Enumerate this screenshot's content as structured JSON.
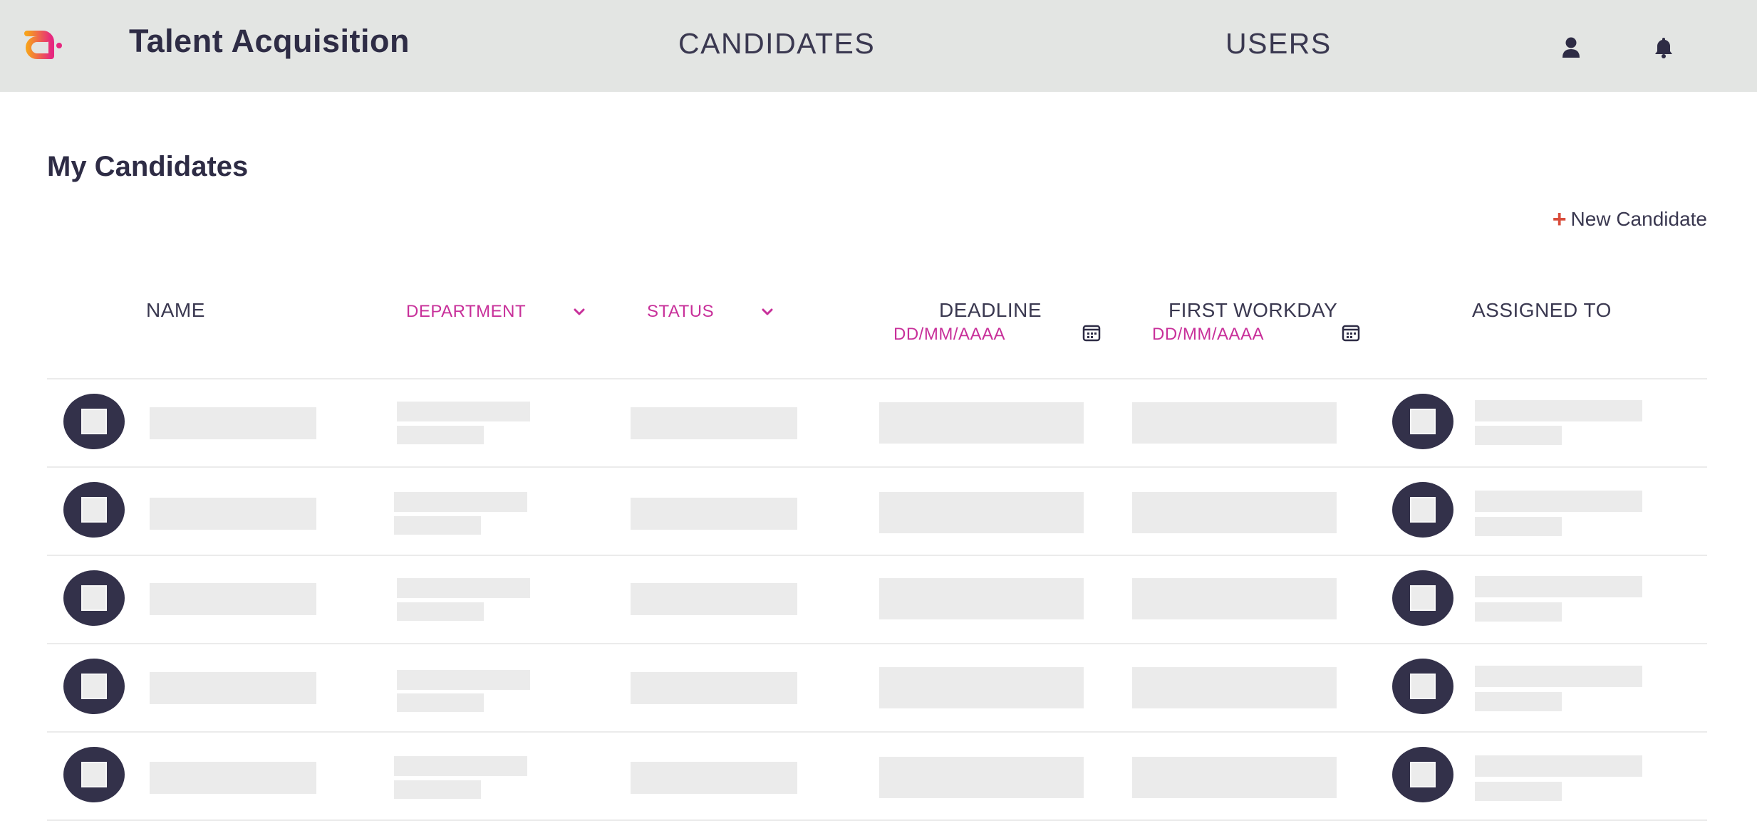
{
  "app": {
    "title": "Talent Acquisition",
    "brand_colors": {
      "logo_orange": "#f7a21b",
      "logo_magenta": "#e6287f"
    }
  },
  "nav": {
    "candidates_label": "CANDIDATES",
    "users_label": "USERS",
    "icons": [
      "user-icon",
      "bell-icon"
    ]
  },
  "page": {
    "title": "My Candidates",
    "new_candidate_label": "New Candidate"
  },
  "table": {
    "columns": {
      "name": "NAME",
      "department": "DEPARTMENT",
      "status": "STATUS",
      "deadline": "DEADLINE",
      "first_workday": "FIRST WORKDAY",
      "assigned_to": "ASSIGNED TO"
    },
    "date_placeholder": "DD/MM/AAAA",
    "filter_color": "#c8309a",
    "row_count": 5,
    "rows_state": "loading-placeholders"
  }
}
